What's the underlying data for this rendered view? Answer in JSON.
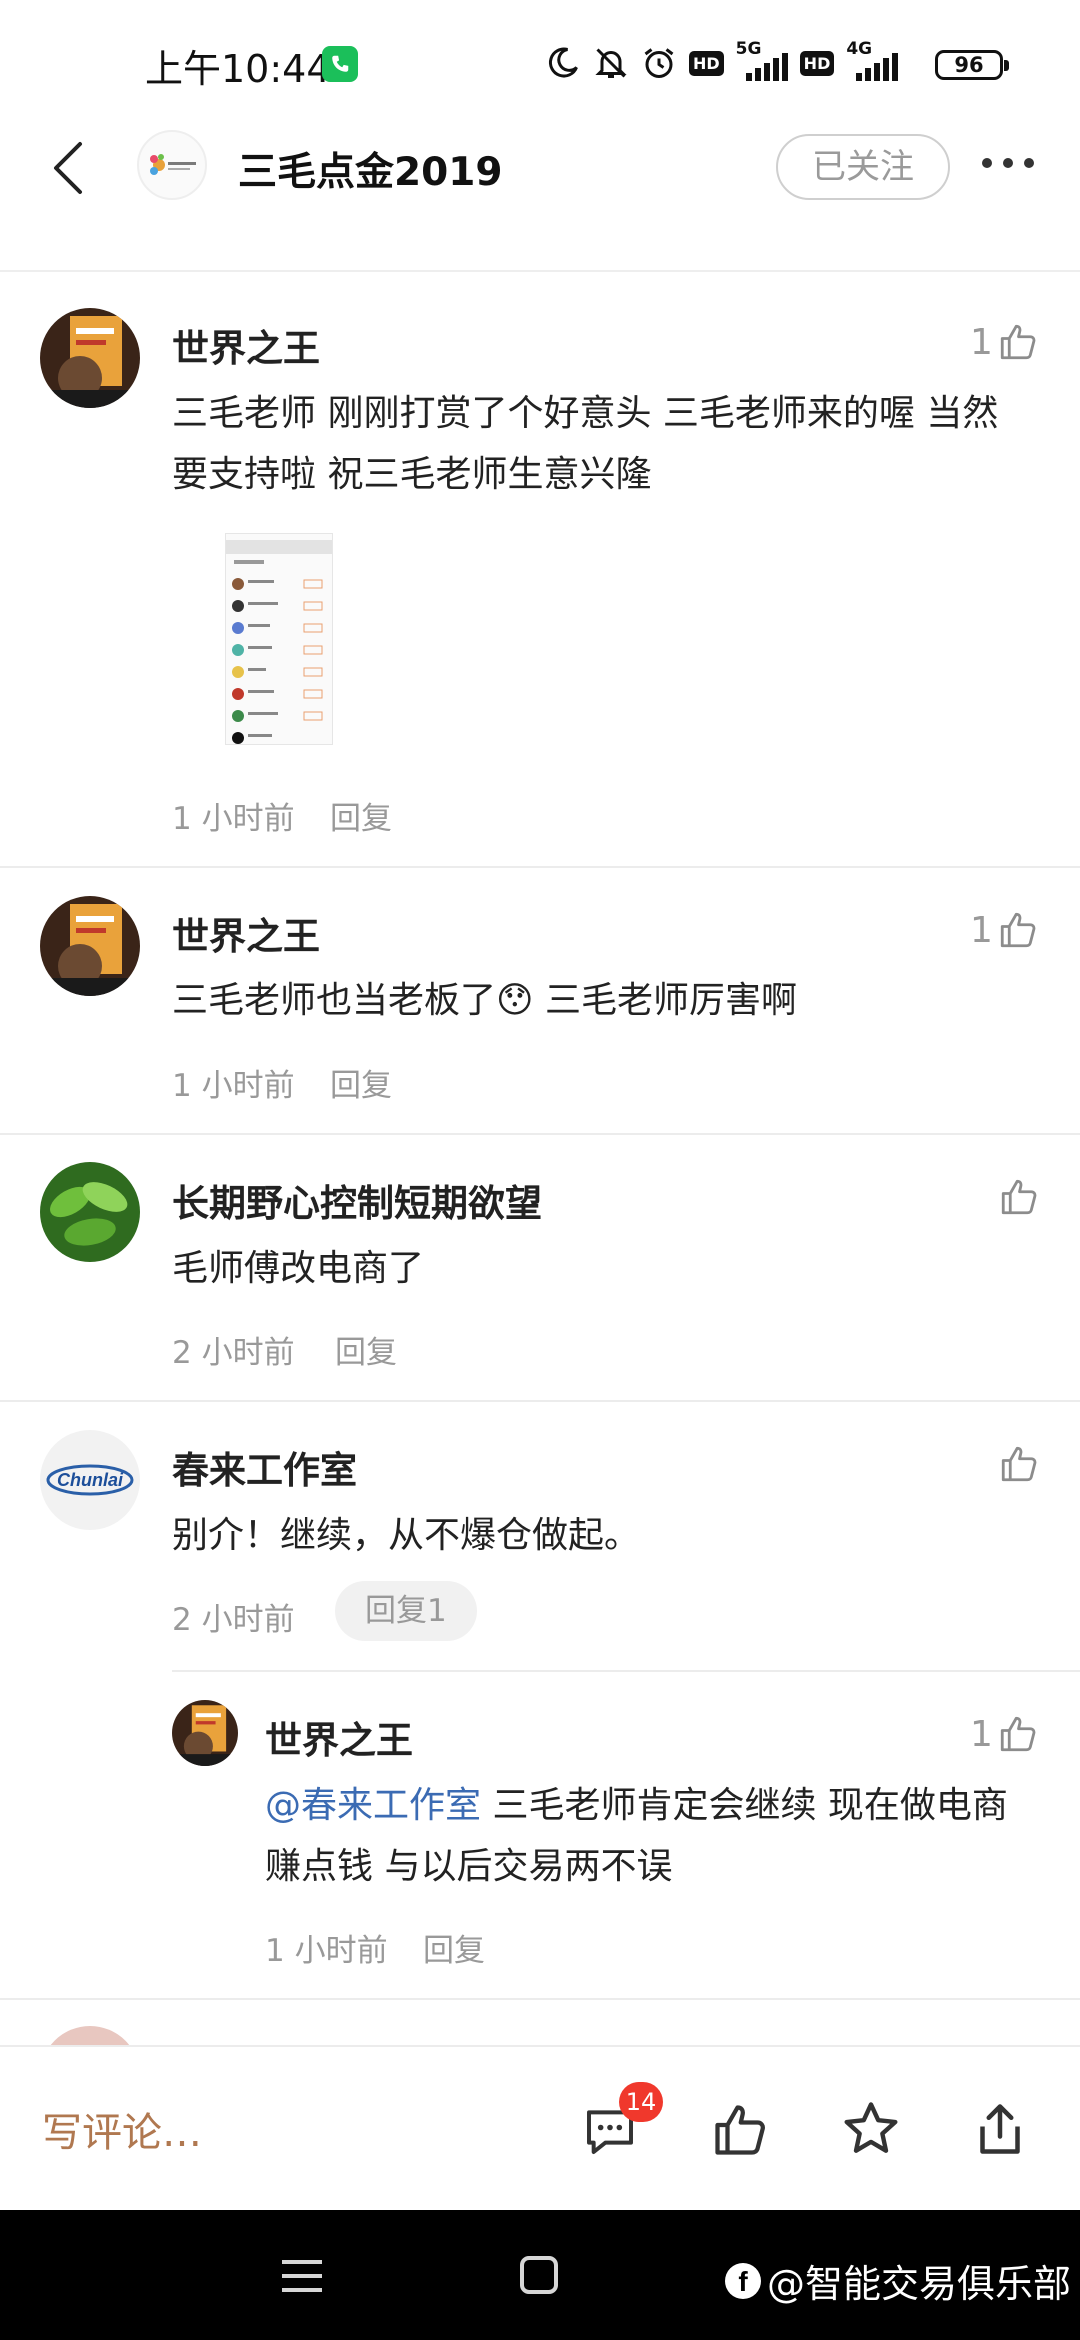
{
  "status_bar": {
    "time": "上午10:44",
    "network1": "5G",
    "network2": "4G",
    "hd1": "HD",
    "hd2": "HD",
    "battery": "96"
  },
  "header": {
    "account_name": "三毛点金2019",
    "follow_label": "已关注"
  },
  "comments": [
    {
      "user": "世界之王",
      "text": "三毛老师 刚刚打赏了个好意头 三毛老师来的喔 当然要支持啦 祝三毛老师生意兴隆",
      "time": "1 小时前",
      "reply_label": "回复",
      "likes": "1"
    },
    {
      "user": "世界之王",
      "text": "三毛老师也当老板了😯 三毛老师厉害啊",
      "time": "1 小时前",
      "reply_label": "回复",
      "likes": "1"
    },
    {
      "user": "长期野心控制短期欲望",
      "text": "毛师傅改电商了",
      "time": "2 小时前",
      "reply_label": "回复",
      "likes": ""
    },
    {
      "user": "春来工作室",
      "avatar_text": "Chunlai",
      "text": "别介！继续，从不爆仓做起。",
      "time": "2 小时前",
      "reply_label": "回复1",
      "likes": "",
      "replies": [
        {
          "user": "世界之王",
          "mention": "@春来工作室",
          "text": " 三毛老师肯定会继续 现在做电商赚点钱 与以后交易两不误",
          "time": "1 小时前",
          "reply_label": "回复",
          "likes": "1"
        }
      ]
    }
  ],
  "bottom_bar": {
    "write_placeholder": "写评论…",
    "comment_count": "14"
  },
  "watermark": {
    "text": "@智能交易俱乐部",
    "logo_letter": "f"
  },
  "colors": {
    "accent_orange": "#b07850",
    "badge_red": "#f0382c",
    "mention_blue": "#3b6bb3"
  }
}
